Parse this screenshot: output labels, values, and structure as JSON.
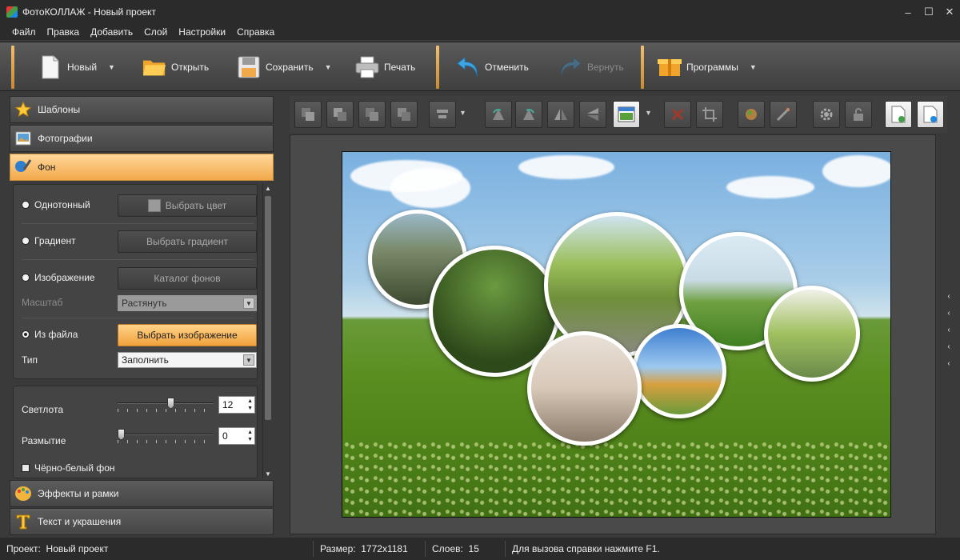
{
  "window": {
    "title": "ФотоКОЛЛАЖ - Новый проект",
    "min": "‒",
    "max": "☐",
    "close": "✕"
  },
  "menu": [
    "Файл",
    "Правка",
    "Добавить",
    "Слой",
    "Настройки",
    "Справка"
  ],
  "toolbar": {
    "new": "Новый",
    "open": "Открыть",
    "save": "Сохранить",
    "print": "Печать",
    "undo": "Отменить",
    "redo": "Вернуть",
    "programs": "Программы"
  },
  "sections": {
    "templates": "Шаблоны",
    "photos": "Фотографии",
    "background": "Фон",
    "effects": "Эффекты и рамки",
    "text": "Текст и украшения"
  },
  "background_panel": {
    "solid_label": "Однотонный",
    "choose_color": "Выбрать цвет",
    "gradient_label": "Градиент",
    "choose_gradient": "Выбрать градиент",
    "image_label": "Изображение",
    "bg_catalog": "Каталог фонов",
    "scale_label": "Масштаб",
    "scale_value": "Растянуть",
    "from_file_label": "Из файла",
    "choose_image": "Выбрать изображение",
    "type_label": "Тип",
    "type_value": "Заполнить",
    "selected_mode": "Из файла",
    "brightness_label": "Светлота",
    "brightness_value": "12",
    "blur_label": "Размытие",
    "blur_value": "0",
    "bw_label": "Чёрно-белый фон",
    "bw_checked": false
  },
  "status": {
    "project_label": "Проект:",
    "project_value": "Новый проект",
    "size_label": "Размер:",
    "size_value": "1772x1181",
    "layers_label": "Слоев:",
    "layers_value": "15",
    "hint": "Для вызова справки нажмите F1."
  },
  "colors": {
    "accent": "#f2a94a",
    "panel": "#3a3a3a"
  },
  "icons": {
    "right_arrows": [
      "‹",
      "‹",
      "‹",
      "‹",
      "‹"
    ],
    "scroll_up": "▲",
    "scroll_down": "▼",
    "dropdown": "▼"
  }
}
